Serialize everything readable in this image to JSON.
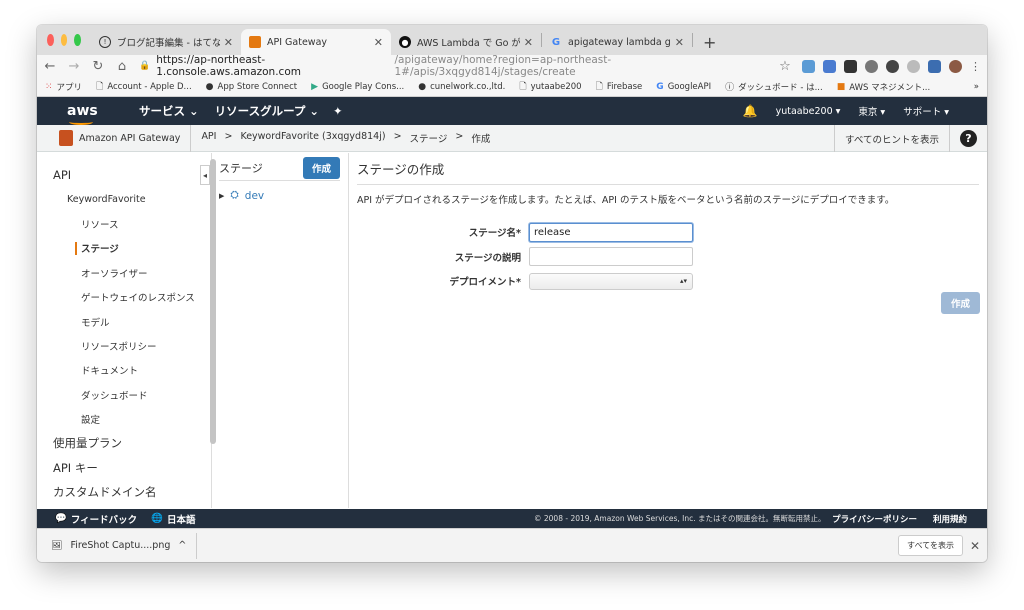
{
  "browser": {
    "tabs": [
      {
        "title": "ブログ記事編集 - はてなブログ",
        "icon": "hatena-icon"
      },
      {
        "title": "API Gateway",
        "icon": "aws-cube-icon",
        "active": true
      },
      {
        "title": "AWS Lambda で Go が使えるよ",
        "icon": "github-icon"
      },
      {
        "title": "apigateway lambda go - Googl",
        "icon": "google-icon"
      }
    ],
    "url_host": "https://ap-northeast-1.console.aws.amazon.com",
    "url_path": "/apigateway/home?region=ap-northeast-1#/apis/3xqgyd814j/stages/create",
    "bookmarks": [
      {
        "label": "アプリ",
        "icon": "apps-grid-icon"
      },
      {
        "label": "Account - Apple D...",
        "icon": "page-icon"
      },
      {
        "label": "App Store Connect",
        "icon": "apple-icon"
      },
      {
        "label": "Google Play Cons...",
        "icon": "play-icon"
      },
      {
        "label": "cunelwork.co.,ltd.",
        "icon": "github-icon"
      },
      {
        "label": "yutaabe200",
        "icon": "page-icon"
      },
      {
        "label": "Firebase",
        "icon": "page-icon"
      },
      {
        "label": "GoogleAPI",
        "icon": "google-icon"
      },
      {
        "label": "ダッシュボード - は...",
        "icon": "hatena-icon"
      },
      {
        "label": "AWS マネジメント...",
        "icon": "aws-cube-icon"
      }
    ],
    "bookmarks_more": "»"
  },
  "aws_header": {
    "logo": "aws",
    "services": "サービス ⌄",
    "resource_groups": "リソースグループ ⌄",
    "user": "yutaabe200 ▾",
    "region": "東京 ▾",
    "support": "サポート ▾"
  },
  "breadcrumb": {
    "service": "Amazon API Gateway",
    "items": [
      "API",
      ">",
      "KeywordFavorite (3xqgyd814j)",
      ">",
      "ステージ",
      ">",
      "作成"
    ],
    "hints": "すべてのヒントを表示",
    "help": "?"
  },
  "leftnav": {
    "api": "API",
    "api_name": "KeywordFavorite",
    "items": [
      "リソース",
      "ステージ",
      "オーソライザー",
      "ゲートウェイのレスポンス",
      "モデル",
      "リソースポリシー",
      "ドキュメント",
      "ダッシュボード",
      "設定"
    ],
    "usage_plans": "使用量プラン",
    "api_keys": "API キー",
    "custom_domains": "カスタムドメイン名"
  },
  "stages": {
    "label": "ステージ",
    "create_button": "作成",
    "items": [
      "dev"
    ]
  },
  "main": {
    "title": "ステージの作成",
    "description": "API がデプロイされるステージを作成します。たとえば、API のテスト版をベータという名前のステージにデプロイできます。",
    "stage_name_label": "ステージ名*",
    "stage_name_value": "release",
    "stage_desc_label": "ステージの説明",
    "stage_desc_value": "",
    "deployment_label": "デプロイメント*",
    "deployment_value": "",
    "create_button": "作成"
  },
  "footer": {
    "feedback": "フィードバック",
    "language": "日本語",
    "copyright": "© 2008 - 2019, Amazon Web Services, Inc. またはその関連会社。無断転用禁止。",
    "privacy": "プライバシーポリシー",
    "terms": "利用規約"
  },
  "download": {
    "file": "FireShot Captu....png",
    "show_all": "すべてを表示"
  },
  "colors": {
    "aws_nav": "#232f3e",
    "aws_orange": "#ff9900",
    "primary_blue": "#337ab7"
  }
}
